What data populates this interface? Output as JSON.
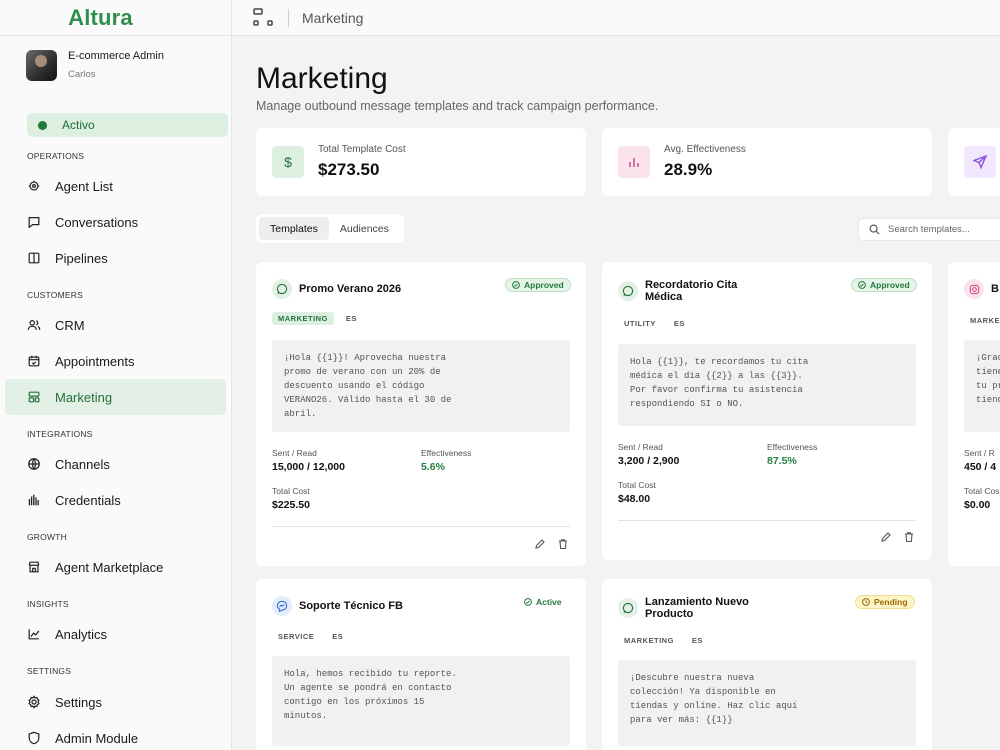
{
  "app": {
    "logo": "Altura",
    "page_crumb": "Marketing"
  },
  "user": {
    "name": "E-commerce Admin",
    "sub": "Carlos"
  },
  "status": {
    "label": "Activo"
  },
  "sidebar": {
    "sections": [
      "OPERATIONS",
      "CUSTOMERS",
      "INTEGRATIONS",
      "GROWTH",
      "INSIGHTS",
      "SETTINGS"
    ],
    "items": [
      {
        "label": "Agent List",
        "icon": "headset-icon"
      },
      {
        "label": "Conversations",
        "icon": "chat-icon"
      },
      {
        "label": "Pipelines",
        "icon": "columns-icon"
      },
      {
        "label": "CRM",
        "icon": "users-icon"
      },
      {
        "label": "Appointments",
        "icon": "calendar-icon"
      },
      {
        "label": "Marketing",
        "icon": "layout-icon"
      },
      {
        "label": "Channels",
        "icon": "globe-icon"
      },
      {
        "label": "Credentials",
        "icon": "key-bars-icon"
      },
      {
        "label": "Agent Marketplace",
        "icon": "store-icon"
      },
      {
        "label": "Analytics",
        "icon": "chart-icon"
      },
      {
        "label": "Settings",
        "icon": "gear-icon"
      },
      {
        "label": "Admin Module",
        "icon": "shield-icon"
      }
    ]
  },
  "main": {
    "title": "Marketing",
    "subtitle": "Manage outbound message templates and track campaign performance.",
    "stats": [
      {
        "label": "Total Template Cost",
        "value": "$273.50",
        "icon": "dollar-icon"
      },
      {
        "label": "Avg. Effectiveness",
        "value": "28.9%",
        "icon": "bar-chart-icon"
      },
      {
        "label": "",
        "value": "",
        "icon": "send-icon"
      }
    ],
    "tabs": [
      "Templates",
      "Audiences"
    ],
    "search_placeholder": "Search templates...",
    "labels": {
      "sent_read": "Sent / Read",
      "effectiveness": "Effectiveness",
      "total_cost": "Total Cost"
    }
  },
  "templates": [
    {
      "title": "Promo Verano 2026",
      "status": "Approved",
      "channel": "whatsapp-icon",
      "category": "MARKETING",
      "lang": "ES",
      "body": "¡Hola {{1}}! Aprovecha nuestra\npromo de verano con un 20% de\ndescuento usando el código\nVERANO26. Válido hasta el 30 de\nabril.",
      "sent_read": "15,000 / 12,000",
      "effectiveness": "5.6%",
      "total_cost": "$225.50"
    },
    {
      "title": "Recordatorio Cita Médica",
      "status": "Approved",
      "channel": "whatsapp-icon",
      "category": "UTILITY",
      "lang": "ES",
      "body": "Hola {{1}}, te recordamos tu cita\nmédica el día {{2}} a las {{3}}.\nPor favor confirma tu asistencia\nrespondiendo SI o NO.",
      "sent_read": "3,200 / 2,900",
      "effectiveness": "87.5%",
      "total_cost": "$48.00"
    },
    {
      "title": "B",
      "channel": "instagram-icon",
      "category": "MARKET",
      "body": "¡Grac\ntiene\ntu pr\ntiend",
      "sent_read_label": "Sent / R",
      "sent_read": "450 / 4",
      "total_cost_label": "Total Cos",
      "total_cost": "$0.00"
    },
    {
      "title": "Soporte Técnico FB",
      "status": "Active",
      "channel": "messenger-icon",
      "category": "SERVICE",
      "lang": "ES",
      "body": "Hola, hemos recibido tu reporte.\nUn agente se pondrá en contacto\ncontigo en los próximos 15\nminutos."
    },
    {
      "title": "Lanzamiento Nuevo Producto",
      "status": "Pending",
      "channel": "whatsapp-icon",
      "category": "MARKETING",
      "lang": "ES",
      "body": "¡Descubre nuestra nueva\ncolección! Ya disponible en\ntiendas y online. Haz clic aquí\npara ver más: {{1}}"
    }
  ],
  "colors": {
    "brand": "#2f8f4e",
    "active_bg": "#e3f0e5",
    "pending": "#9a6a00"
  }
}
